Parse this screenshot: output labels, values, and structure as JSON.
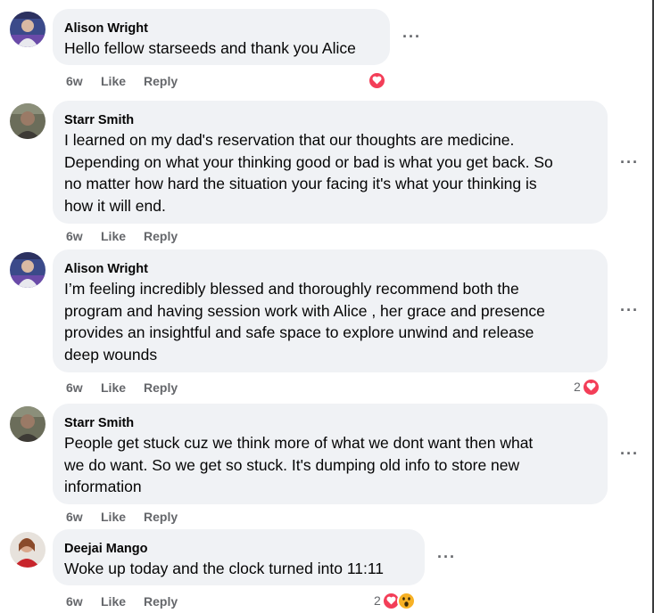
{
  "comments": [
    {
      "author": "Alison Wright",
      "lines": [
        "Hello fellow starseeds and thank you Alice"
      ],
      "time": "6w",
      "like": "Like",
      "reply": "Reply",
      "reaction_count": "",
      "reactions": [
        "heart-icon"
      ]
    },
    {
      "author": "Starr Smith",
      "lines": [
        "I learned on my dad's reservation that our thoughts are medicine.",
        "Depending on what your thinking good or bad is what you get back. So",
        "no matter how hard the situation your facing it's what your thinking is",
        "how it will end."
      ],
      "time": "6w",
      "like": "Like",
      "reply": "Reply",
      "reaction_count": "",
      "reactions": []
    },
    {
      "author": "Alison Wright",
      "lines": [
        "I’m feeling incredibly blessed and thoroughly recommend both the",
        "program and having session work with Alice , her grace and presence",
        "provides an insightful and safe space to explore unwind and release",
        "deep wounds"
      ],
      "time": "6w",
      "like": "Like",
      "reply": "Reply",
      "reaction_count": "2",
      "reactions": [
        "heart-icon"
      ]
    },
    {
      "author": "Starr Smith",
      "lines": [
        "People get stuck cuz we think more of what we dont want then what",
        "we do want. So we get so stuck. It's dumping old info to store new",
        "information"
      ],
      "time": "6w",
      "like": "Like",
      "reply": "Reply",
      "reaction_count": "",
      "reactions": []
    },
    {
      "author": "Deejai Mango",
      "lines": [
        "Woke up today and the clock turned into 11:11"
      ],
      "time": "6w",
      "like": "Like",
      "reply": "Reply",
      "reaction_count": "2",
      "reactions": [
        "heart-icon",
        "wow-icon"
      ]
    }
  ],
  "more_label": "···",
  "colors": {
    "bubble": "#f0f2f5",
    "meta": "#65676b",
    "heart": "#f33e58",
    "wow": "#f7b125"
  }
}
